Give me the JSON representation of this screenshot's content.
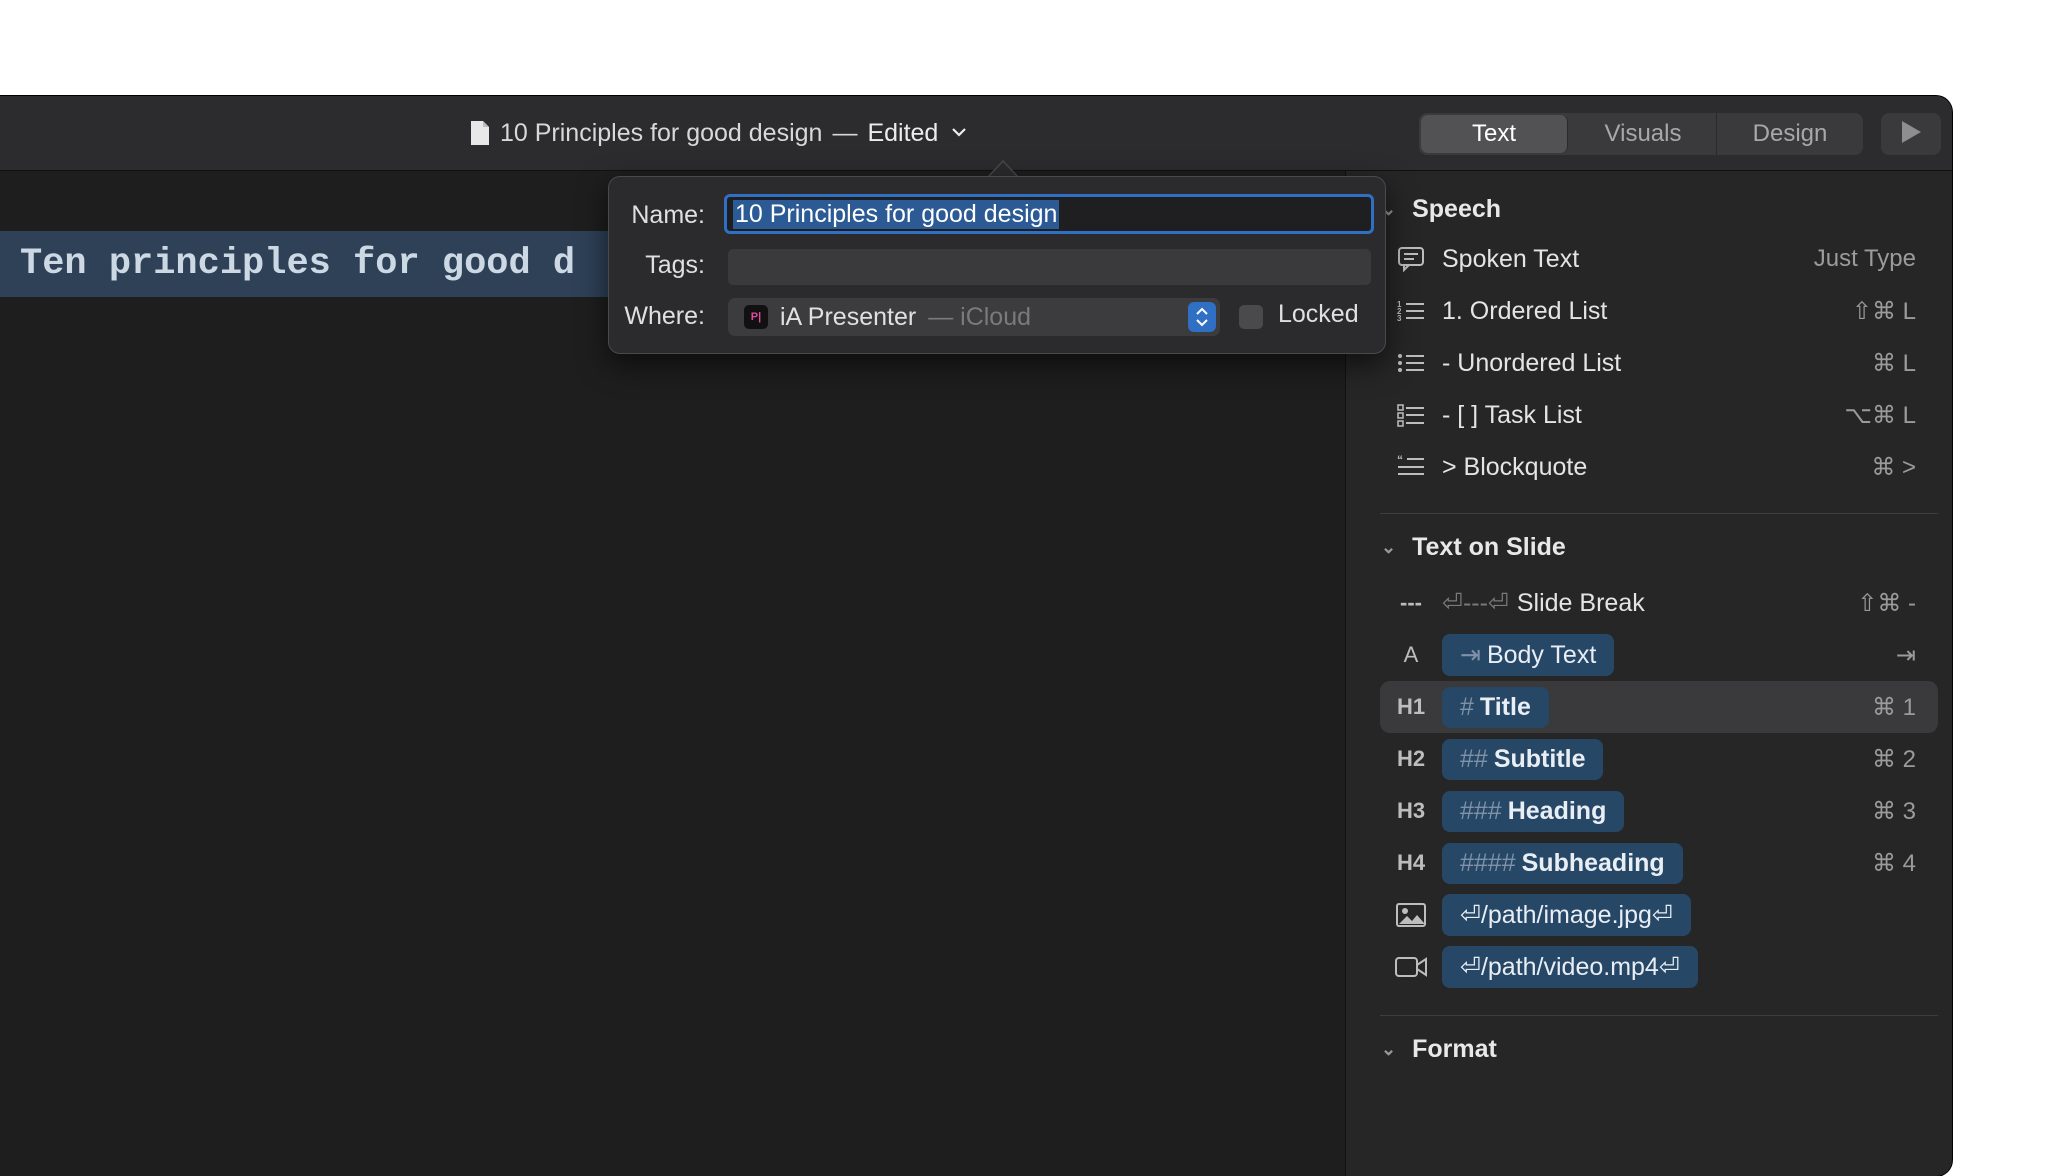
{
  "window": {
    "doc_title": "10 Principles for good design",
    "separator": "—",
    "edited_label": "Edited",
    "icon": "document-icon"
  },
  "toolbar": {
    "tabs": [
      {
        "label": "Text",
        "active": true
      },
      {
        "label": "Visuals",
        "active": false
      },
      {
        "label": "Design",
        "active": false
      }
    ],
    "play_icon": "play-icon"
  },
  "editor": {
    "heading_line": "Ten principles for good d"
  },
  "popover": {
    "name_label": "Name:",
    "name_value": "10 Principles for good design",
    "tags_label": "Tags:",
    "tags_value": "",
    "where_label": "Where:",
    "where_app": "iA Presenter",
    "where_location": "— iCloud",
    "locked_label": "Locked",
    "locked_checked": false
  },
  "sidebar": {
    "speech": {
      "title": "Speech",
      "items": [
        {
          "icon": "speech-bubble-icon",
          "label": "Spoken Text",
          "shortcut": "Just Type"
        },
        {
          "icon": "ordered-list-icon",
          "label": "1. Ordered List",
          "shortcut": "⇧⌘ L"
        },
        {
          "icon": "unordered-list-icon",
          "label": "- Unordered List",
          "shortcut": "⌘ L"
        },
        {
          "icon": "task-list-icon",
          "label": "- [ ] Task List",
          "shortcut": "⌥⌘ L"
        },
        {
          "icon": "blockquote-icon",
          "label": "> Blockquote",
          "shortcut": "⌘ >"
        }
      ]
    },
    "text_on_slide": {
      "title": "Text on Slide",
      "slide_break": {
        "icon_text": "---",
        "prefix": "⏎---⏎",
        "label": "Slide Break",
        "shortcut": "⇧⌘ -"
      },
      "body_text": {
        "icon_text": "A",
        "prefix": "⇥",
        "label": "Body Text",
        "shortcut": "⇥"
      },
      "title_item": {
        "icon_text": "H1",
        "prefix": "#",
        "label": "Title",
        "shortcut": "⌘ 1"
      },
      "subtitle_item": {
        "icon_text": "H2",
        "prefix": "##",
        "label": "Subtitle",
        "shortcut": "⌘ 2"
      },
      "heading_item": {
        "icon_text": "H3",
        "prefix": "###",
        "label": "Heading",
        "shortcut": "⌘ 3"
      },
      "subheading_item": {
        "icon_text": "H4",
        "prefix": "####",
        "label": "Subheading",
        "shortcut": "⌘ 4"
      },
      "image_item": {
        "icon": "image-icon",
        "label": "⏎/path/image.jpg⏎"
      },
      "video_item": {
        "icon": "video-camera-icon",
        "label": "⏎/path/video.mp4⏎"
      }
    },
    "format": {
      "title": "Format"
    }
  },
  "colors": {
    "accent": "#2f6fc4",
    "pill_bg": "#264766",
    "window_bg": "#1e1e1e",
    "sidebar_bg": "#262626"
  }
}
